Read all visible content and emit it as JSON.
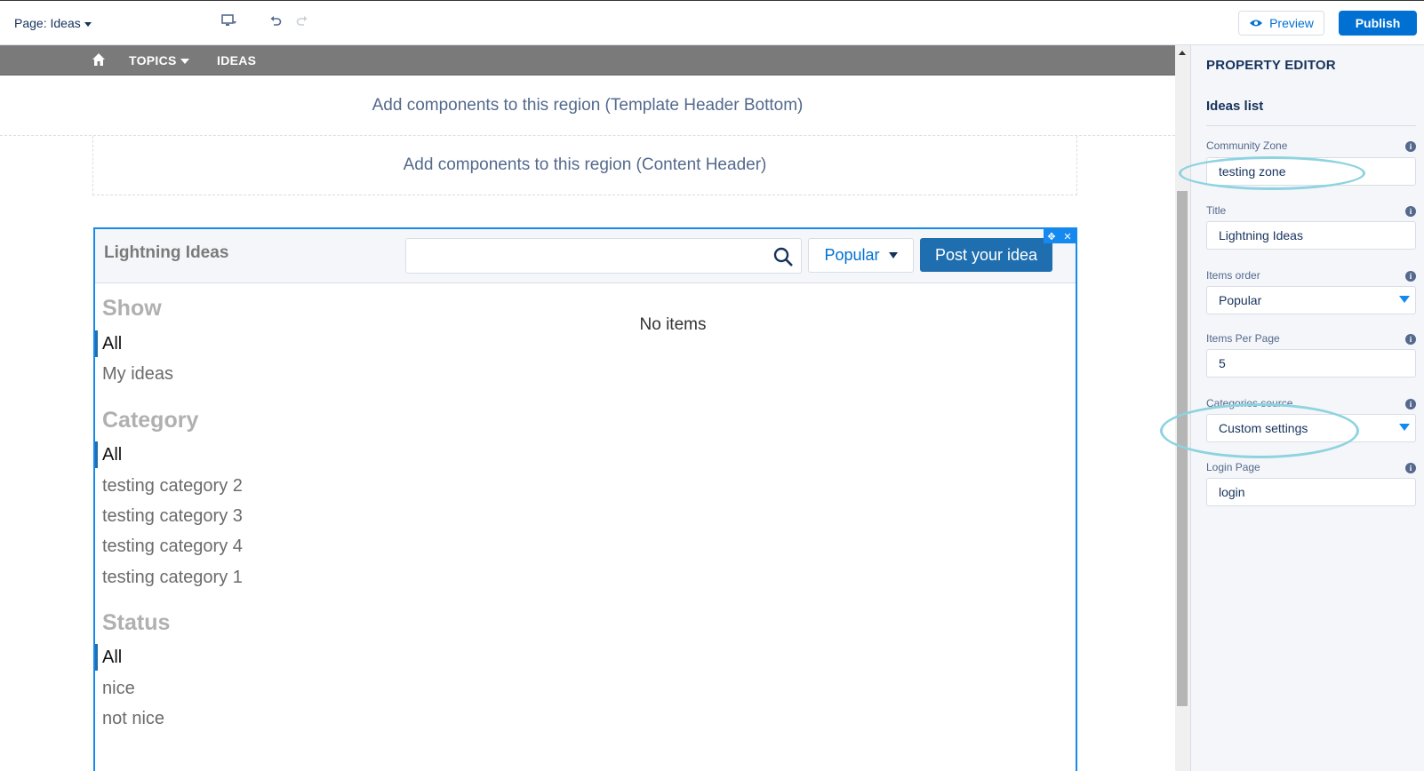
{
  "topbar": {
    "page_label": "Page: Ideas",
    "preview_label": "Preview",
    "publish_label": "Publish"
  },
  "nav": {
    "topics_label": "TOPICS",
    "ideas_label": "IDEAS"
  },
  "regions": {
    "template_header_bottom": "Add components to this region (Template Header Bottom)",
    "content_header": "Add components to this region (Content Header)"
  },
  "ideas_component": {
    "title": "Lightning Ideas",
    "search_value": "",
    "sort_label": "Popular",
    "post_label": "Post your idea",
    "empty_message": "No items",
    "show": {
      "title": "Show",
      "items": [
        "All",
        "My ideas"
      ]
    },
    "category": {
      "title": "Category",
      "items": [
        "All",
        "testing category 2",
        "testing category 3",
        "testing category 4",
        "testing category 1"
      ]
    },
    "status": {
      "title": "Status",
      "items": [
        "All",
        "nice",
        "not nice"
      ]
    }
  },
  "property_editor": {
    "heading": "PROPERTY EDITOR",
    "component_name": "Ideas list",
    "fields": {
      "community_zone": {
        "label": "Community Zone",
        "value": "testing zone"
      },
      "title": {
        "label": "Title",
        "value": "Lightning Ideas"
      },
      "items_order": {
        "label": "Items order",
        "value": "Popular"
      },
      "items_per_page": {
        "label": "Items Per Page",
        "value": "5"
      },
      "categories_source": {
        "label": "Categories source",
        "value": "Custom settings"
      },
      "login_page": {
        "label": "Login Page",
        "value": "login"
      }
    }
  },
  "colors": {
    "accent": "#0070d2",
    "nav_bg": "#7a7a7a",
    "selection_border": "#1589ee",
    "annotation": "#8dd3e0"
  }
}
